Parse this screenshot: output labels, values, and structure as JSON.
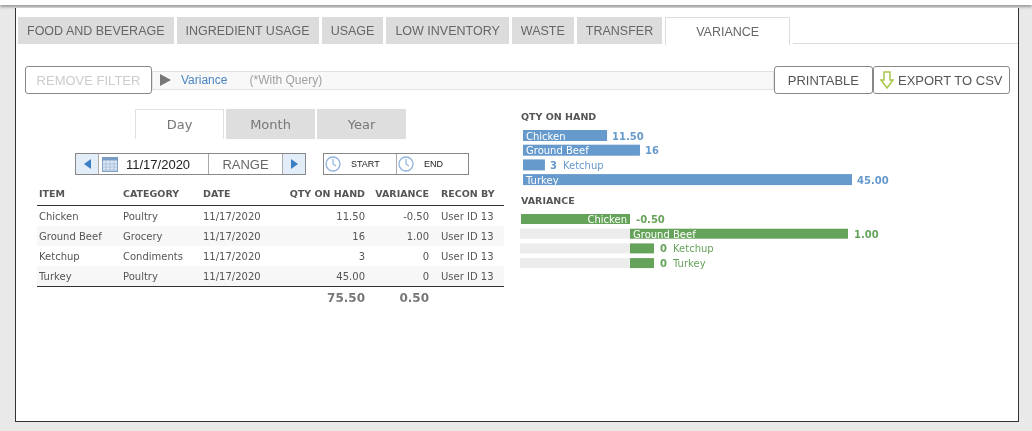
{
  "tabs": [
    {
      "label": "FOOD AND BEVERAGE",
      "selected": false
    },
    {
      "label": "INGREDIENT USAGE",
      "selected": false
    },
    {
      "label": "USAGE",
      "selected": false
    },
    {
      "label": "LOW INVENTORY",
      "selected": false
    },
    {
      "label": "WASTE",
      "selected": false
    },
    {
      "label": "TRANSFER",
      "selected": false
    },
    {
      "label": "VARIANCE",
      "selected": true
    }
  ],
  "toolbar": {
    "remove_filter": {
      "label": "REMOVE FILTER",
      "disabled": true
    },
    "breadcrumb": "Variance",
    "query_note": "(*With Query)",
    "buttons": [
      "PRINTABLE",
      "EXPORT TO CSV"
    ]
  },
  "period_tabs": [
    {
      "label": "Day",
      "selected": true
    },
    {
      "label": "Month",
      "selected": false
    },
    {
      "label": "Year",
      "selected": false
    }
  ],
  "date_picker": {
    "value": "11/17/2020",
    "range_label": "RANGE",
    "start_label": "START",
    "end_label": "END"
  },
  "table": {
    "columns": [
      "ITEM",
      "CATEGORY",
      "DATE",
      "QTY ON HAND",
      "VARIANCE",
      "RECON BY"
    ],
    "rows": [
      [
        "Chicken",
        "Poultry",
        "11/17/2020",
        "11.50",
        "-0.50",
        "User ID 13"
      ],
      [
        "Ground Beef",
        "Grocery",
        "11/17/2020",
        "16",
        "1.00",
        "User ID 13"
      ],
      [
        "Ketchup",
        "Condiments",
        "11/17/2020",
        "3",
        "0",
        "User ID 13"
      ],
      [
        "Turkey",
        "Poultry",
        "11/17/2020",
        "45.00",
        "0",
        "User ID 13"
      ]
    ],
    "totals": [
      "75.50",
      "0.50"
    ]
  },
  "charts": [
    {
      "chart_data": {
        "type": "bar",
        "orientation": "horizontal",
        "categories": [
          "Chicken",
          "Ground Beef",
          "Ketchup",
          "Turkey"
        ],
        "series": [
          {
            "name": "QTY ON HAND",
            "color": "#6699cc",
            "values": [
              11.5,
              16,
              3,
              45
            ],
            "value_labels": [
              "11.50",
              "16",
              "3",
              "45.00"
            ]
          }
        ]
      }
    },
    {
      "chart_data": {
        "type": "bar",
        "orientation": "horizontal",
        "categories": [
          "Chicken",
          "Ground Beef",
          "Ketchup",
          "Turkey"
        ],
        "series": [
          {
            "name": "VARIANCE",
            "color": "#66a35a",
            "values": [
              -0.5,
              1,
              0,
              0
            ],
            "value_labels": [
              "-0.50",
              "1.00",
              "0",
              "0"
            ]
          }
        ]
      }
    }
  ]
}
